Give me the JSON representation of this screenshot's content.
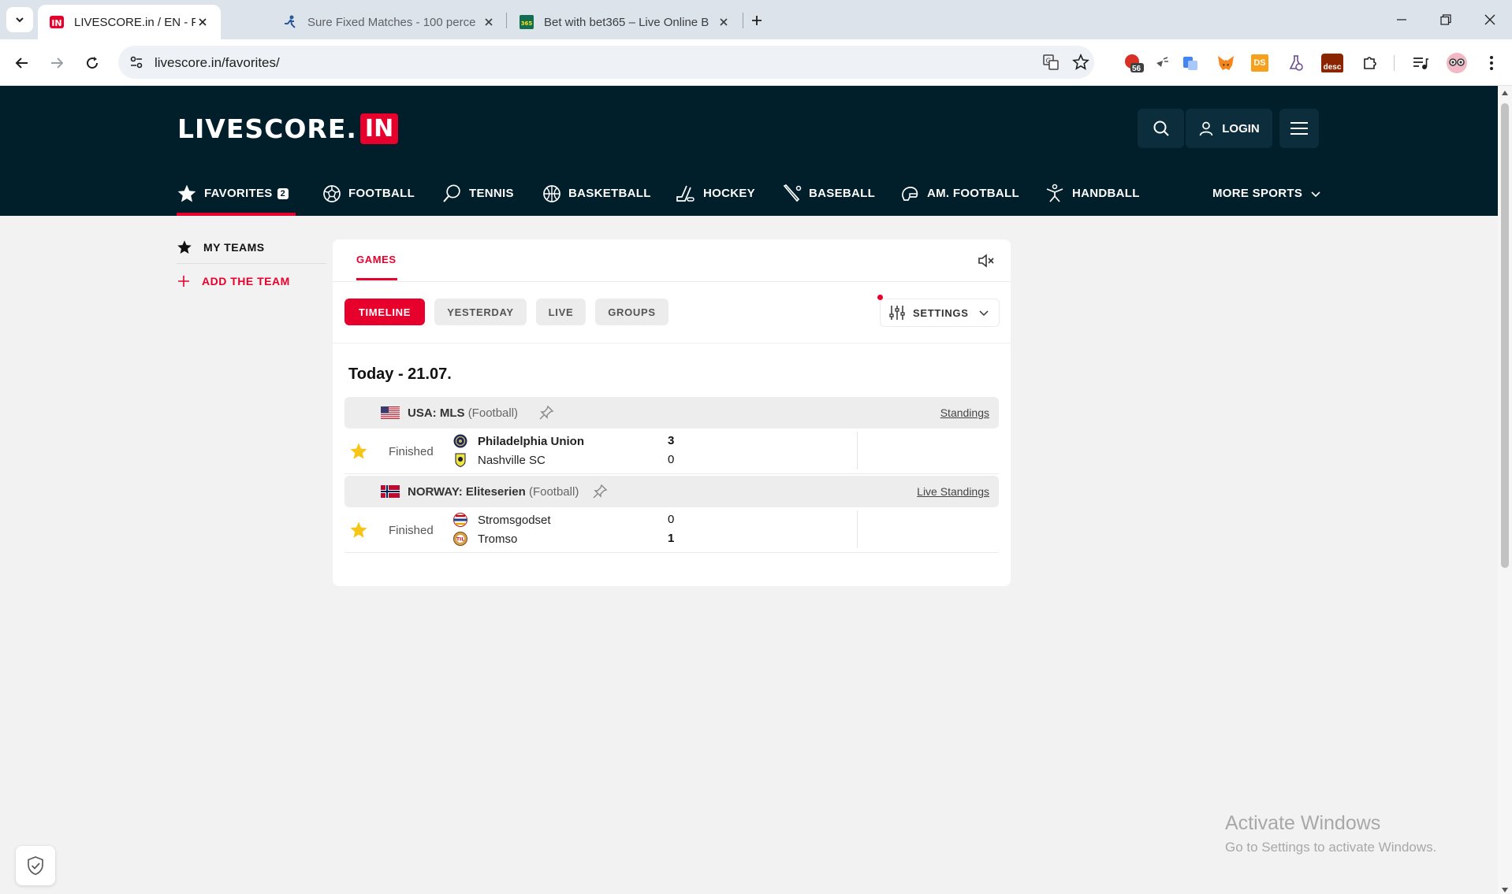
{
  "browser": {
    "tabs": [
      {
        "title": "LIVESCORE.in / EN - Favorites",
        "active": true
      },
      {
        "title": "Sure Fixed Matches - 100 perce",
        "active": false
      },
      {
        "title": "Bet with bet365 – Live Online B",
        "active": false
      }
    ],
    "url": "livescore.in/favorites/",
    "extension_badges": {
      "counter": "56",
      "desc": "desc",
      "ds": "DS"
    }
  },
  "site": {
    "logo_word": "LIVESCORE.",
    "logo_in": "IN",
    "login_label": "LOGIN",
    "nav": {
      "favorites": "FAVORITES",
      "favorites_count": "2",
      "football": "FOOTBALL",
      "tennis": "TENNIS",
      "basketball": "BASKETBALL",
      "hockey": "HOCKEY",
      "baseball": "BASEBALL",
      "am_football": "AM. FOOTBALL",
      "handball": "HANDBALL",
      "more_sports": "MORE SPORTS"
    },
    "brand_color": "#e8002d",
    "header_color": "#011e2b"
  },
  "sidebar": {
    "my_teams": "MY TEAMS",
    "add_team": "ADD THE TEAM"
  },
  "main": {
    "games_tab": "GAMES",
    "filters": [
      "TIMELINE",
      "YESTERDAY",
      "LIVE",
      "GROUPS"
    ],
    "settings_label": "SETTINGS",
    "date_title": "Today - 21.07.",
    "leagues": [
      {
        "country": "USA:",
        "name": "MLS",
        "sport": "(Football)",
        "standings": "Standings",
        "match": {
          "status": "Finished",
          "home": "Philadelphia Union",
          "away": "Nashville SC",
          "home_score": "3",
          "away_score": "0"
        }
      },
      {
        "country": "NORWAY:",
        "name": "Eliteserien",
        "sport": "(Football)",
        "standings": "Live Standings",
        "match": {
          "status": "Finished",
          "home": "Stromsgodset",
          "away": "Tromso",
          "home_score": "0",
          "away_score": "1"
        }
      }
    ]
  },
  "os_overlay": {
    "line1": "Activate Windows",
    "line2": "Go to Settings to activate Windows."
  }
}
